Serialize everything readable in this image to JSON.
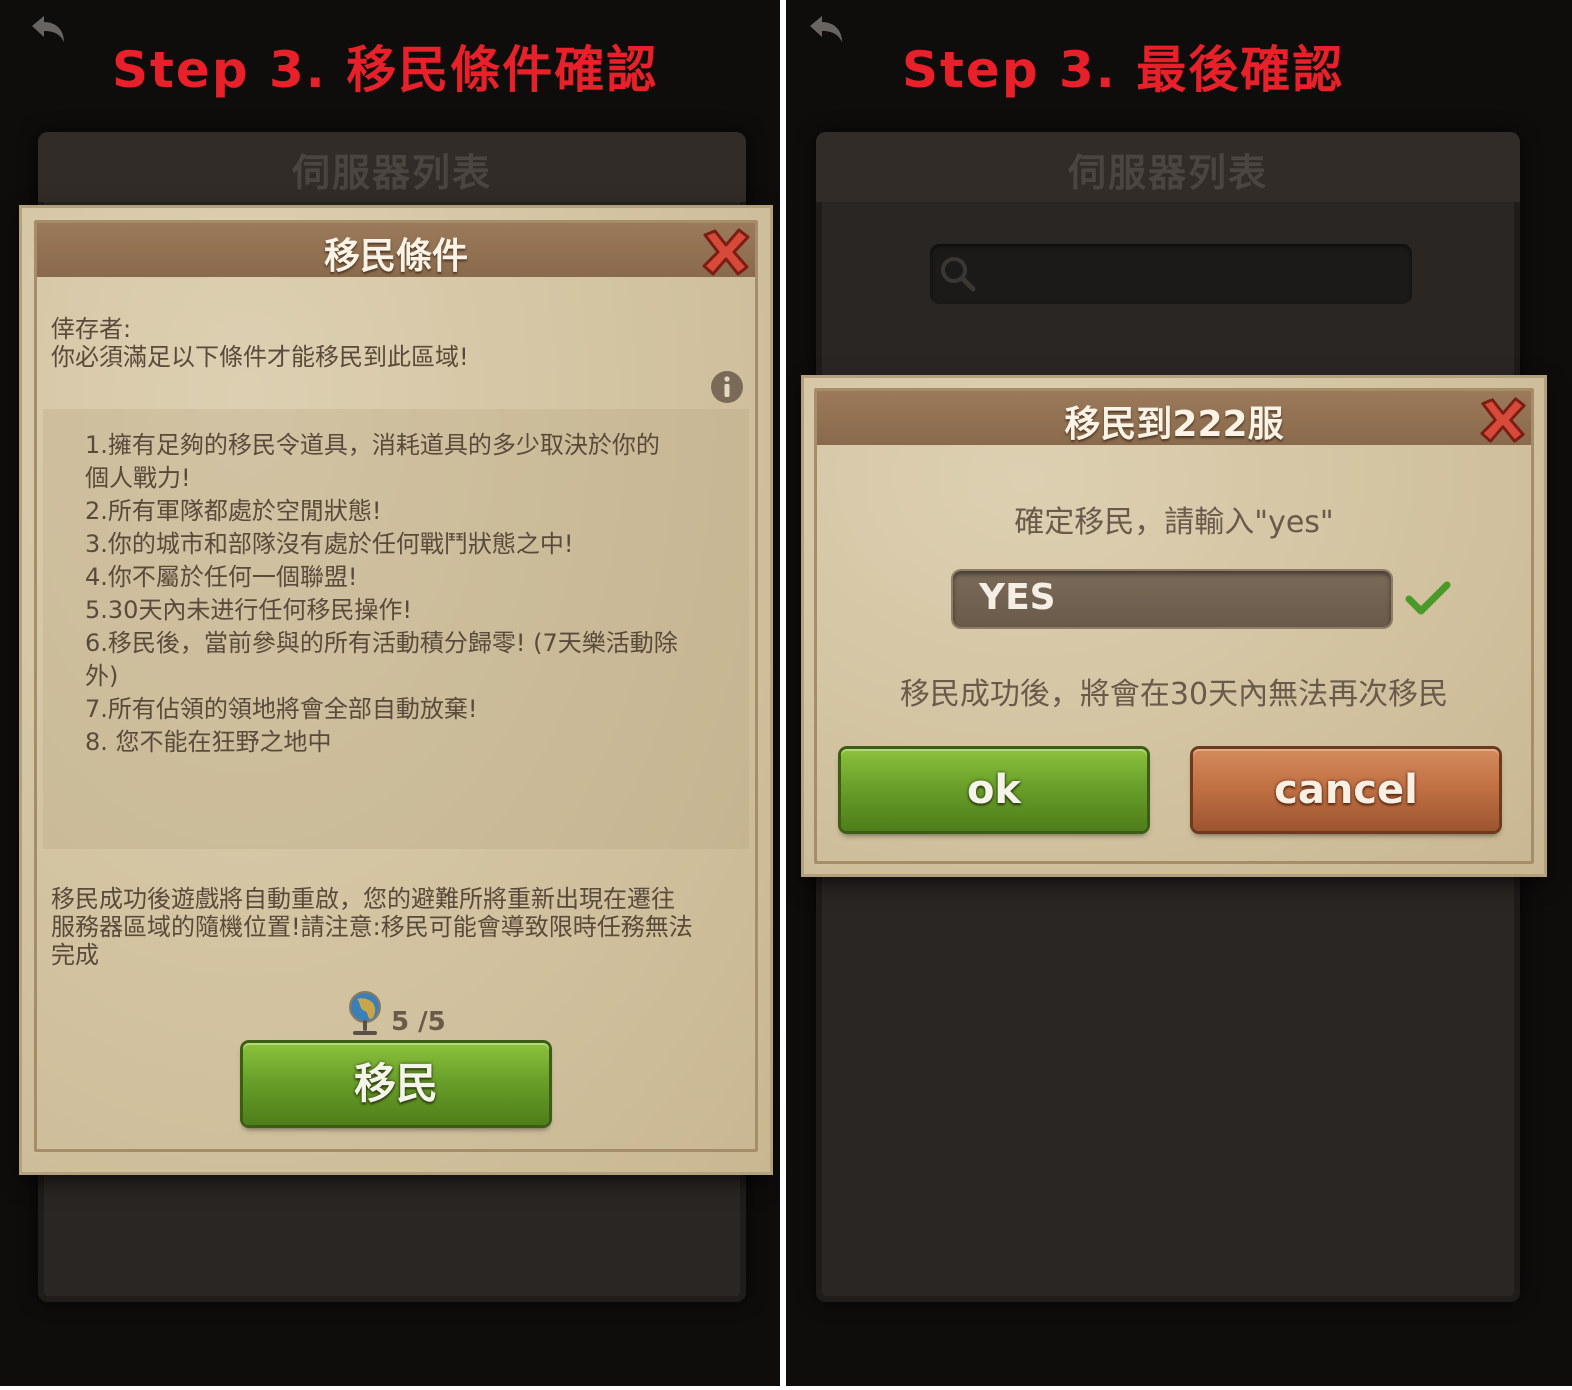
{
  "left": {
    "step_title": "Step 3. 移民條件確認",
    "server_list_title": "伺服器列表",
    "dialog": {
      "title": "移民條件",
      "greeting": "倖存者:",
      "intro": "你必須滿足以下條件才能移民到此區域!",
      "conditions": [
        "1.擁有足夠的移民令道具，消耗道具的多少取決於你的",
        "個人戰力!",
        "2.所有軍隊都處於空閒狀態!",
        "3.你的城市和部隊沒有處於任何戰鬥狀態之中!",
        "4.你不屬於任何一個聯盟!",
        "5.30天內未进行任何移民操作!",
        "6.移民後，當前參與的所有活動積分歸零! (7天樂活動除",
        "外)",
        "7.所有佔領的領地將會全部自動放棄!",
        "8. 您不能在狂野之地中"
      ],
      "notice_lines": [
        "移民成功後遊戲將自動重啟，您的避難所將重新出現在遷往",
        "服務器區域的隨機位置!請注意:移民可能會導致限時任務無法",
        "完成"
      ],
      "item_count": "5 /5",
      "migrate_button": "移民"
    }
  },
  "right": {
    "step_title": "Step 3. 最後確認",
    "server_list_title": "伺服器列表",
    "dialog": {
      "title": "移民到222服",
      "prompt": "確定移民，請輸入\"yes\"",
      "input_value": "YES",
      "warning": "移民成功後，將會在30天內無法再次移民",
      "ok_button": "ok",
      "cancel_button": "cancel"
    }
  },
  "icons": {
    "back": "back-arrow-icon",
    "close": "close-x-icon",
    "info": "info-icon",
    "search": "search-icon",
    "check": "checkmark-icon",
    "globe": "globe-icon"
  },
  "colors": {
    "step_title": "#e8202a",
    "check": "#4a9a2a"
  }
}
